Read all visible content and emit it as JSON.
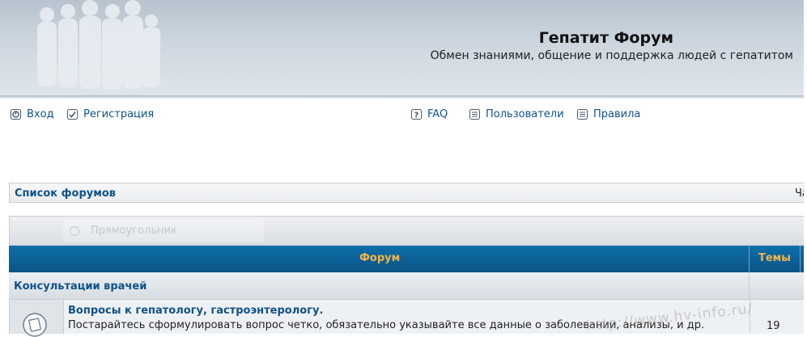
{
  "header": {
    "title": "Гепатит Форум",
    "description": "Обмен знаниями, общение и поддержка людей с гепатитом"
  },
  "nav": {
    "login": "Вход",
    "register": "Регистрация",
    "faq": "FAQ",
    "members": "Пользователи",
    "rules": "Правила"
  },
  "breadcrumb": {
    "index": "Список форумов",
    "right_text": "Ча"
  },
  "toolbar": {
    "ghost_label": "Прямоугольник"
  },
  "table": {
    "headers": {
      "forum": "Форум",
      "topics": "Темы"
    },
    "category": "Консультации врачей",
    "rows": [
      {
        "title": "Вопросы к гепатологу, гастроэнтерологу.",
        "description": "Постарайтесь сформулировать вопрос четко, обязательно указывайте все данные о заболевании, анализы, и др.",
        "topics": "19"
      }
    ]
  },
  "watermark": "http://www.hv-info.ru/",
  "colors": {
    "link": "#105289",
    "header_bar": "#0a5486",
    "header_text": "#f3b34a"
  }
}
